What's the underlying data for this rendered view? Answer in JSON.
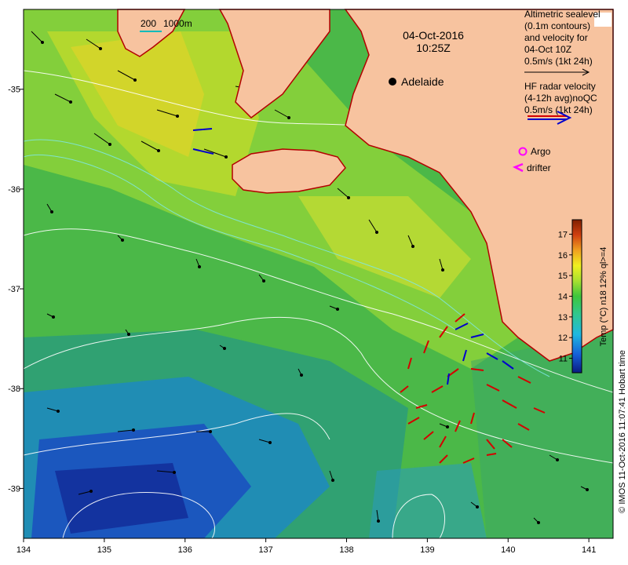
{
  "map": {
    "date_title": "04-Oct-2016",
    "time_title": "10:25Z",
    "city_label": "Adelaide",
    "scale_bar": {
      "label_a": "200",
      "label_b": "1000m"
    },
    "x_ticks": [
      "134",
      "135",
      "136",
      "137",
      "138",
      "139",
      "140",
      "141"
    ],
    "y_ticks": [
      "-35",
      "-36",
      "-37",
      "-38",
      "-39"
    ],
    "x_range": [
      134,
      141.3
    ],
    "y_range": [
      -39.5,
      -34.2
    ],
    "colors": {
      "land": "#f7c39f",
      "coast": "#b30000",
      "altimetry_arrow": "#000000",
      "hf_radar_arrow": "#d40000",
      "hf_radar_blue": "#0000cc",
      "argo": "#ff00ff",
      "drifter": "#ff00ff",
      "contour": "#ffffff"
    }
  },
  "legend": {
    "altimetry_lines": [
      "Altimetric sealevel",
      "(0.1m contours)",
      "and velocity for",
      "04-Oct 10Z",
      "0.5m/s (1kt 24h)"
    ],
    "radar_lines": [
      "HF radar velocity",
      "(4-12h avg)noQC",
      "0.5m/s (1kt 24h)"
    ],
    "argo_label": "Argo",
    "drifter_label": "drifter"
  },
  "colorbar": {
    "ticks": [
      "11",
      "12",
      "13",
      "14",
      "15",
      "16",
      "17"
    ],
    "range": [
      10.3,
      17.7
    ],
    "label": "Temp (°C) n18 12% ql>=4"
  },
  "credit": "© IMOS 11-Oct-2016 11:07:41 Hobart time"
}
